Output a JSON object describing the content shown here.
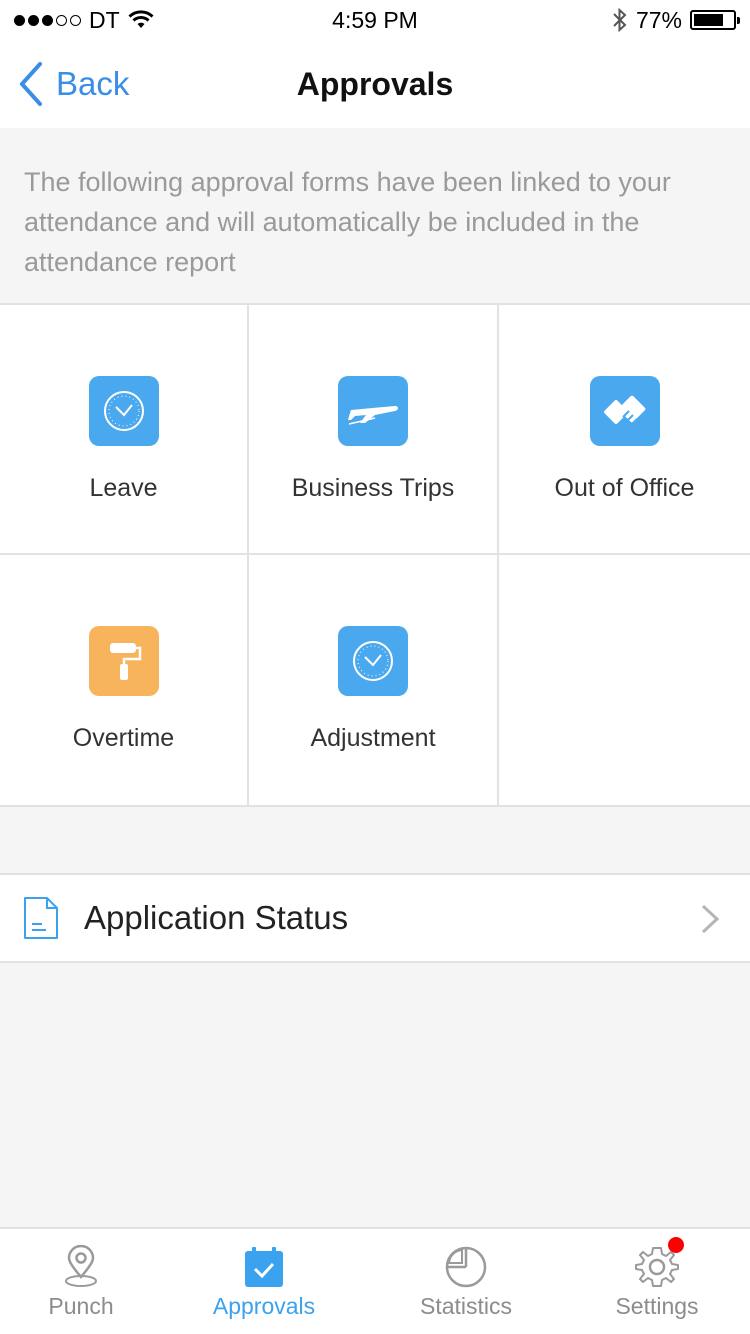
{
  "status_bar": {
    "carrier": "DT",
    "time": "4:59 PM",
    "battery_percent": "77%",
    "battery_level": 0.77
  },
  "nav": {
    "back_label": "Back",
    "title": "Approvals"
  },
  "description": "The following approval forms have been linked to your attendance and will automatically be included in the attendance report",
  "forms": [
    {
      "label": "Leave",
      "icon": "clock-icon",
      "color": "#4aa8ef"
    },
    {
      "label": "Business Trips",
      "icon": "airplane-icon",
      "color": "#4aa8ef"
    },
    {
      "label": "Out of Office",
      "icon": "handshake-icon",
      "color": "#4aa8ef"
    },
    {
      "label": "Overtime",
      "icon": "paint-roller-icon",
      "color": "#f7b45c"
    },
    {
      "label": "Adjustment",
      "icon": "clock-icon",
      "color": "#4aa8ef"
    }
  ],
  "application_status": {
    "label": "Application Status",
    "icon": "document-icon"
  },
  "tabs": [
    {
      "label": "Punch",
      "icon": "location-pin-icon",
      "active": false
    },
    {
      "label": "Approvals",
      "icon": "calendar-check-icon",
      "active": true
    },
    {
      "label": "Statistics",
      "icon": "pie-chart-icon",
      "active": false
    },
    {
      "label": "Settings",
      "icon": "gear-icon",
      "active": false,
      "badge": true
    }
  ],
  "colors": {
    "accent": "#3aa2ee",
    "back_link": "#3a8ee6",
    "icon_blue": "#4aa8ef",
    "icon_orange": "#f7b45c",
    "badge": "#ff0000"
  }
}
